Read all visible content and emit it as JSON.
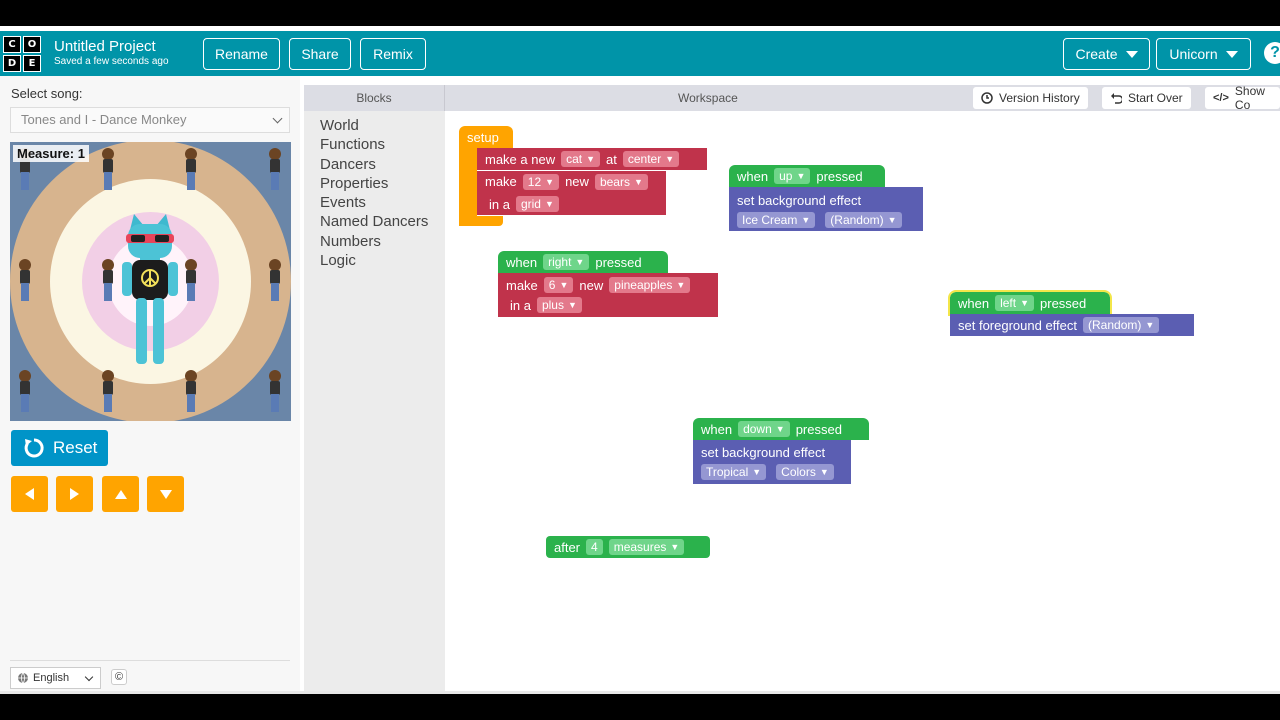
{
  "header": {
    "logo_letters": [
      "C",
      "O",
      "D",
      "E"
    ],
    "project_title": "Untitled Project",
    "project_subtitle": "Saved a few seconds ago",
    "rename_label": "Rename",
    "share_label": "Share",
    "remix_label": "Remix",
    "create_label": "Create",
    "user_label": "Unicorn",
    "help_label": "?"
  },
  "left": {
    "song_label": "Select song:",
    "song_value": "Tones and I - Dance Monkey",
    "measure_label": "Measure: 1",
    "reset_label": "Reset",
    "language": "English",
    "copyright": "©"
  },
  "toolbox": {
    "header": "Blocks",
    "categories": [
      "World",
      "Functions",
      "Dancers",
      "Properties",
      "Events",
      "Named Dancers",
      "Numbers",
      "Logic"
    ]
  },
  "workspace": {
    "header": "Workspace",
    "version_history": "Version History",
    "start_over": "Start Over",
    "show_code": "Show Co"
  },
  "blocks": {
    "setup": {
      "hat": "setup",
      "l1_a": "make a new",
      "l1_b": "cat",
      "l1_c": "at",
      "l1_d": "center",
      "l2_a": "make",
      "l2_b": "12",
      "l2_c": "new",
      "l2_d": "bears",
      "l3_a": "in a",
      "l3_b": "grid"
    },
    "up": {
      "when": "when",
      "key": "up",
      "pressed": "pressed",
      "cmd": "set background effect",
      "opt1": "Ice Cream",
      "opt2": "(Random)"
    },
    "right": {
      "when": "when",
      "key": "right",
      "pressed": "pressed",
      "l1_a": "make",
      "l1_b": "6",
      "l1_c": "new",
      "l1_d": "pineapples",
      "l2_a": "in a",
      "l2_b": "plus"
    },
    "left": {
      "when": "when",
      "key": "left",
      "pressed": "pressed",
      "cmd": "set foreground effect",
      "opt": "(Random)"
    },
    "down": {
      "when": "when",
      "key": "down",
      "pressed": "pressed",
      "cmd": "set background effect",
      "opt1": "Tropical",
      "opt2": "Colors"
    },
    "after": {
      "a": "after",
      "n": "4",
      "b": "measures"
    }
  },
  "colors": {
    "header": "#0094a8",
    "event_green": "#2bb24c",
    "dancer_red": "#c0334b",
    "world_purple": "#5b5eb2",
    "setup_orange": "#ffa400"
  }
}
